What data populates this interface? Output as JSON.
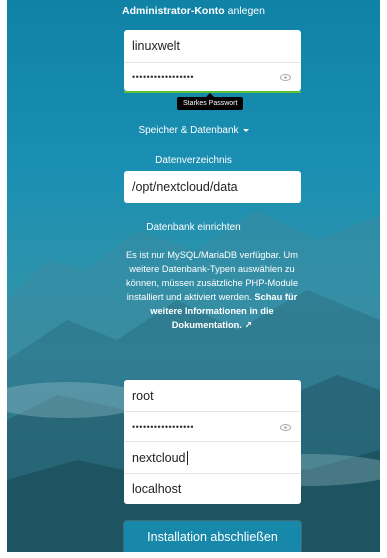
{
  "admin": {
    "title_bold": "Administrator-Konto",
    "title_rest": " anlegen",
    "username": "linuxwelt",
    "password_mask": "•••••••••••••••••",
    "tooltip": "Starkes Passwort"
  },
  "storage": {
    "toggle_label": "Speicher & Datenbank",
    "datadir_label": "Datenverzeichnis",
    "datadir_value": "/opt/nextcloud/data",
    "db_label": "Datenbank einrichten",
    "info_text": "Es ist nur MySQL/MariaDB verfügbar. Um weitere Datenbank-Typen auswählen zu können, müssen zusätzliche PHP-Module installiert und aktiviert werden.",
    "info_link": "Schau für weitere Informationen in die Dokumentation. ↗"
  },
  "database": {
    "user": "root",
    "password_mask": "•••••••••••••••••",
    "name": "nextcloud",
    "host": "localhost"
  },
  "submit_label": "Installation abschließen",
  "colors": {
    "accent": "#1787aa",
    "strength": "#5bc236"
  }
}
